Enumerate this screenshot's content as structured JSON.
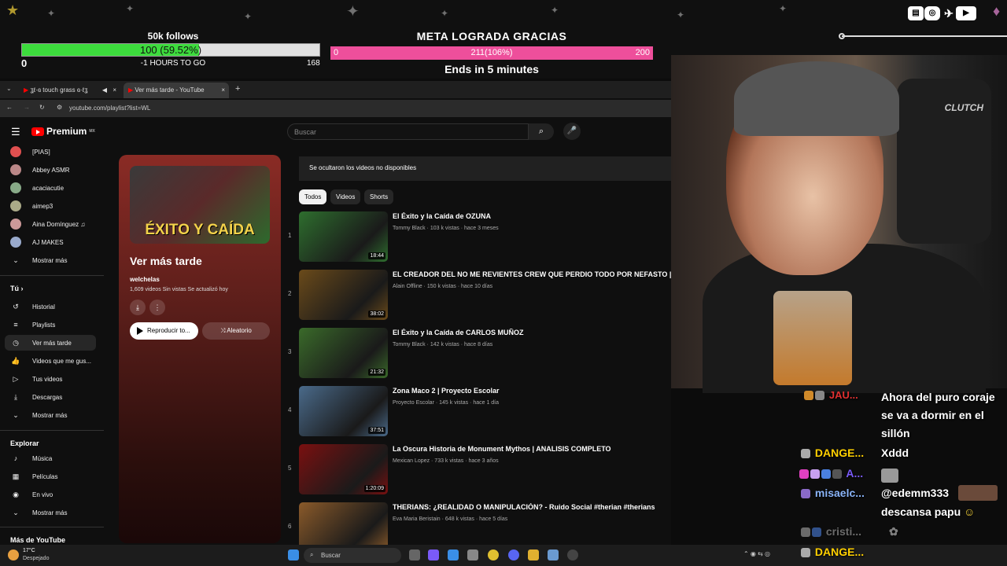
{
  "overlay": {
    "follow_title": "50k follows",
    "follow_value": "100 (59.52%)",
    "follow_progress": 0.5952,
    "follow_min": "0",
    "follow_time": "-1 HOURS TO GO",
    "follow_max": "168",
    "meta_title": "META LOGRADA GRACIAS",
    "meta_value": "211(106%)",
    "meta_min": "0",
    "meta_max": "200",
    "meta_ends": "Ends in 5 minutes",
    "social_icons": [
      "twitch-icon",
      "instagram-icon",
      "twitter-icon",
      "youtube-icon"
    ]
  },
  "browser": {
    "tabs": [
      {
        "label": "ʓℓ·ɞ touch grass ɞ·ℓʓ",
        "icon": "youtube-icon"
      },
      {
        "label": "Ver más tarde - YouTube",
        "icon": "youtube-icon"
      }
    ],
    "url": "youtube.com/playlist?list=WL"
  },
  "youtube": {
    "logo": "Premium",
    "logo_region": "MX",
    "search_placeholder": "Buscar",
    "subscriptions": [
      "[PIAS]",
      "Abbey ASMR",
      "acaciacutie",
      "aimep3",
      "Aina Domínguez ♫",
      "AJ MAKES",
      "Mostrar más"
    ],
    "you_section": "Tú",
    "you_items": [
      "Historial",
      "Playlists",
      "Ver más tarde",
      "Videos que me gus...",
      "Tus videos",
      "Descargas",
      "Mostrar más"
    ],
    "explore_section": "Explorar",
    "explore_items": [
      "Música",
      "Películas",
      "En vivo",
      "Mostrar más"
    ],
    "more_section": "Más de YouTube",
    "playlist": {
      "thumb_text": "ÉXITO Y CAÍDA",
      "title": "Ver más tarde",
      "owner": "welchelas",
      "meta": "1,609 videos   Sin vistas   Se actualizó hoy",
      "play_all": "Reproducir to...",
      "shuffle": "Aleatorio"
    },
    "hidden_note": "Se ocultaron los videos no disponibles",
    "chips": [
      "Todos",
      "Videos",
      "Shorts"
    ],
    "videos": [
      {
        "index": "1",
        "title": "El Éxito y la Caída de OZUNA",
        "meta": "Tommy Black · 103 k vistas · hace 3 meses",
        "duration": "18:44",
        "color": "#2e6e2e"
      },
      {
        "index": "2",
        "title": "EL CREADOR DEL NO ME REVIENTES CREW QUE PERDIO TODO POR NEFASTO | Yayo G",
        "meta": "Alain Offline · 150 k vistas · hace 10 días",
        "duration": "38:02",
        "color": "#6a4a1a"
      },
      {
        "index": "3",
        "title": "El Éxito y la Caída de CARLOS MUÑOZ",
        "meta": "Tommy Black · 142 k vistas · hace 8 días",
        "duration": "21:32",
        "color": "#3a6a2a"
      },
      {
        "index": "4",
        "title": "Zona Maco 2 | Proyecto Escolar",
        "meta": "Proyecto Escolar · 145 k vistas · hace 1 día",
        "duration": "37:51",
        "color": "#4a6a8a"
      },
      {
        "index": "5",
        "title": "La Oscura Historia de Monument Mythos | ANALISIS COMPLETO",
        "meta": "Mexican Lopez · 733 k vistas · hace 3 años",
        "duration": "1:20:09",
        "color": "#7a1010"
      },
      {
        "index": "6",
        "title": "THERIANS: ¿REALIDAD O MANIPULACIÓN? - Ruido Social #therian #therians",
        "meta": "Eva Maria Beristain · 648 k vistas · hace 5 días",
        "duration": "",
        "color": "#8a5a2a"
      }
    ]
  },
  "chat": [
    {
      "user": "JAU...",
      "text": "Ahora del puro coraje se va a dormir en el sillón",
      "color": "#e03030"
    },
    {
      "user": "DANGE...",
      "text": "Xddd",
      "color": "#ffd000"
    },
    {
      "user": "A...",
      "text": "",
      "color": "#7a5af8"
    },
    {
      "user": "misaelc...",
      "text": "@edemm333",
      "color": "#8ab4f8"
    },
    {
      "user": "",
      "text": "descansa papu",
      "color": "#fff"
    },
    {
      "user": "cristi...",
      "text": "",
      "color": "#aaa"
    },
    {
      "user": "DANGE...",
      "text": "",
      "color": "#ffd000"
    }
  ],
  "taskbar": {
    "weather_temp": "17°C",
    "weather_desc": "Despejado",
    "search": "Buscar"
  }
}
